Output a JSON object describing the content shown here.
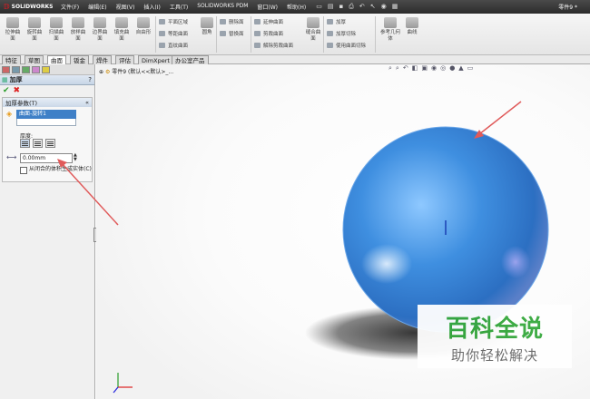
{
  "app": {
    "logo_text": "SOLIDWORKS",
    "doc_title": "零件9 *"
  },
  "menu": [
    "文件(F)",
    "编辑(E)",
    "视图(V)",
    "插入(I)",
    "工具(T)",
    "SOLIDWORKS PDM",
    "窗口(W)",
    "帮助(H)"
  ],
  "ribbon": {
    "big_buttons": [
      "拉伸曲面",
      "旋转曲面",
      "扫描曲面",
      "放样曲面",
      "边界曲面",
      "填充曲面",
      "自由形"
    ],
    "col1": [
      "平面区域",
      "等距曲面",
      "直纹曲面"
    ],
    "fillet": "圆角",
    "col2": [
      "删除面",
      "替换面"
    ],
    "col3": [
      "延伸曲面",
      "剪裁曲面",
      "解除剪裁曲面"
    ],
    "knit": "缝合曲面",
    "col4": [
      "加厚",
      "加厚切除",
      "使用曲面切除"
    ],
    "ref": "参考几何体",
    "curves": "曲线"
  },
  "tabs": [
    "特征",
    "草图",
    "曲面",
    "钣金",
    "焊件",
    "评估",
    "DimXpert",
    "办公室产品"
  ],
  "panel": {
    "title": "加厚",
    "group_title": "加厚参数(T)",
    "selected_face": "曲面-旋转1",
    "thickness_label": "厚度:",
    "thickness_value": "0.00mm",
    "checkbox_label": "从闭合的体积生成实体(C)"
  },
  "viewport": {
    "tree_item": "零件9 (默认<<默认>_..."
  },
  "watermark": {
    "title": "百科全说",
    "subtitle": "助你轻松解决"
  },
  "colors": {
    "sphere": "#3f8fe0",
    "arrow": "#e05a5a",
    "watermark_green": "#35a83c"
  }
}
